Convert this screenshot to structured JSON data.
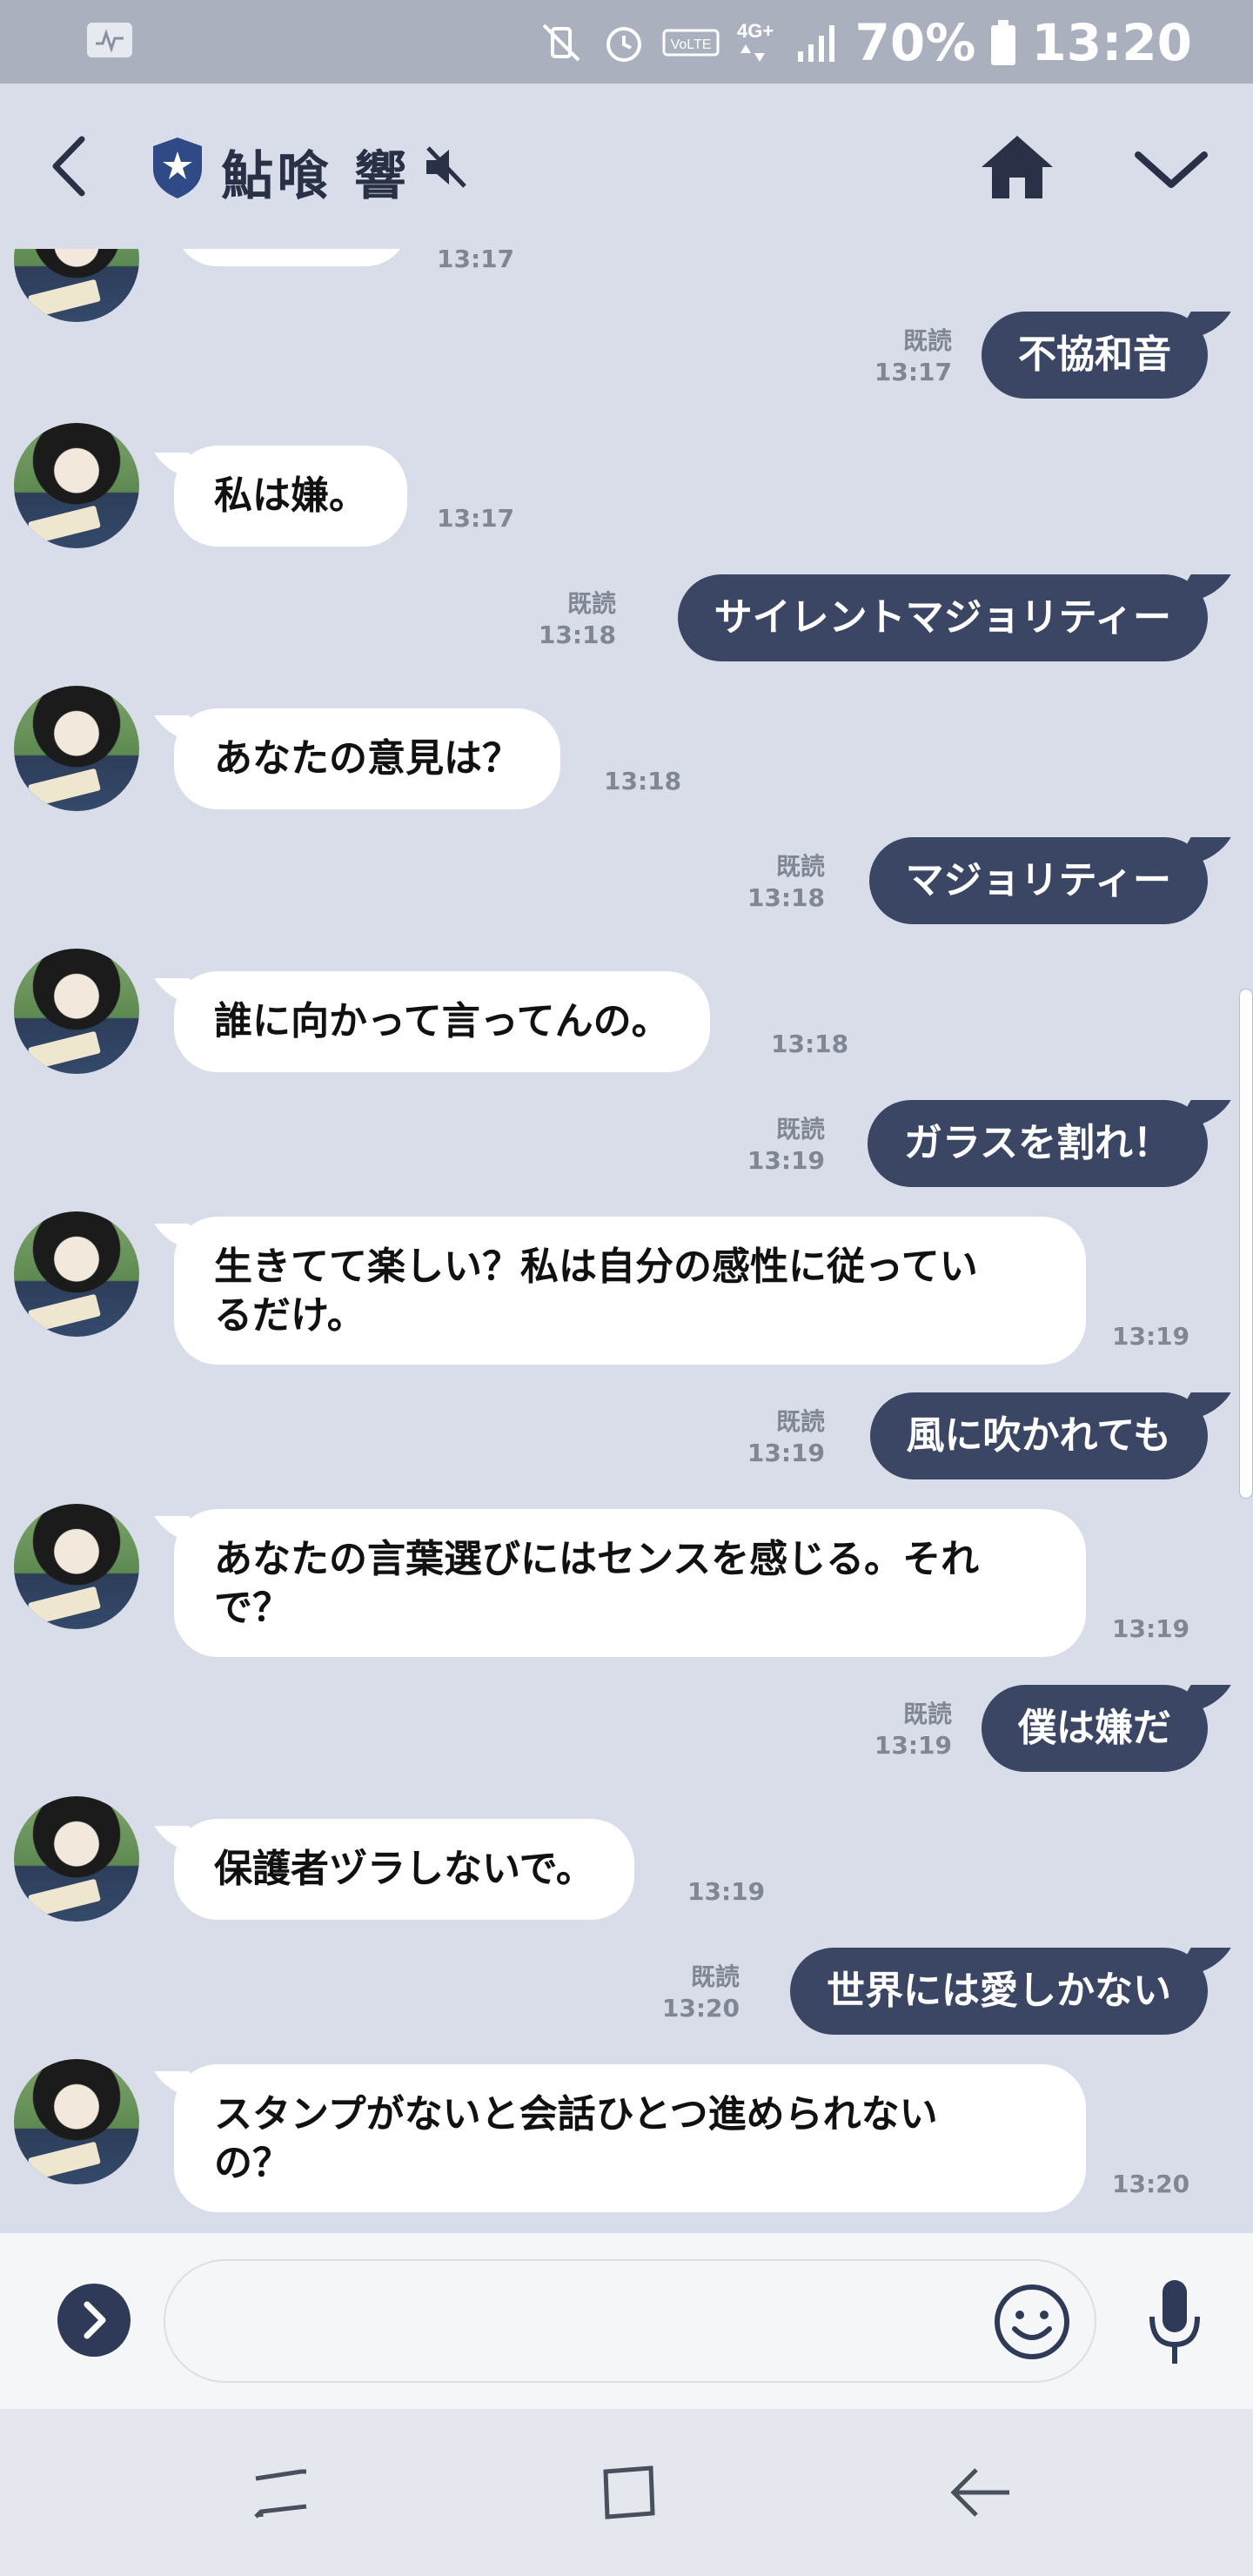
{
  "status_bar": {
    "battery": "70%",
    "time": "13:20",
    "network": "4G+",
    "volte": "VoLTE"
  },
  "header": {
    "title": "鮎喰 響",
    "icons": [
      "back-icon",
      "shield-star-icon",
      "mute-icon",
      "home-icon",
      "chevron-down-icon"
    ]
  },
  "messages": [
    {
      "dir": "in",
      "text": "",
      "time": "13:17"
    },
    {
      "dir": "out",
      "text": "不協和音",
      "read": "既読",
      "time": "13:17"
    },
    {
      "dir": "in",
      "text": "私は嫌。",
      "time": "13:17"
    },
    {
      "dir": "out",
      "text": "サイレントマジョリティー",
      "read": "既読",
      "time": "13:18"
    },
    {
      "dir": "in",
      "text": "あなたの意見は？",
      "time": "13:18"
    },
    {
      "dir": "out",
      "text": "マジョリティー",
      "read": "既読",
      "time": "13:18"
    },
    {
      "dir": "in",
      "text": "誰に向かって言ってんの。",
      "time": "13:18"
    },
    {
      "dir": "out",
      "text": "ガラスを割れ！",
      "read": "既読",
      "time": "13:19"
    },
    {
      "dir": "in",
      "text": "生きてて楽しい？私は自分の感性に従ってい\nるだけ。",
      "time": "13:19"
    },
    {
      "dir": "out",
      "text": "風に吹かれても",
      "read": "既読",
      "time": "13:19"
    },
    {
      "dir": "in",
      "text": "あなたの言葉選びにはセンスを感じる。それ\nで？",
      "time": "13:19"
    },
    {
      "dir": "out",
      "text": "僕は嫌だ",
      "read": "既読",
      "time": "13:19"
    },
    {
      "dir": "in",
      "text": "保護者ヅラしないで。",
      "time": "13:19"
    },
    {
      "dir": "out",
      "text": "世界には愛しかない",
      "read": "既読",
      "time": "13:20"
    },
    {
      "dir": "in",
      "text": "スタンプがないと会話ひとつ進められない\nの？",
      "time": "13:20"
    }
  ],
  "input": {
    "placeholder": ""
  },
  "colors": {
    "background": "#d8dde9",
    "outgoing": "#3a4663",
    "incoming": "#ffffff",
    "title": "#2a3147"
  }
}
